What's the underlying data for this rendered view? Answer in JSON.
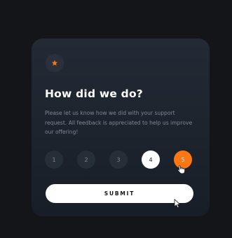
{
  "card": {
    "icon": "star-icon",
    "title": "How did we do?",
    "description": "Please let us know how we did with your support request. All feedback is appreciated to help us improve our offering!",
    "ratings": [
      "1",
      "2",
      "3",
      "4",
      "5"
    ],
    "submit_label": "SUBMIT"
  },
  "colors": {
    "page_background": "#141519",
    "card_background": "#1f2630",
    "accent_orange": "#fc7614",
    "muted_text": "#7d8796",
    "rating_bg": "#262e38"
  }
}
